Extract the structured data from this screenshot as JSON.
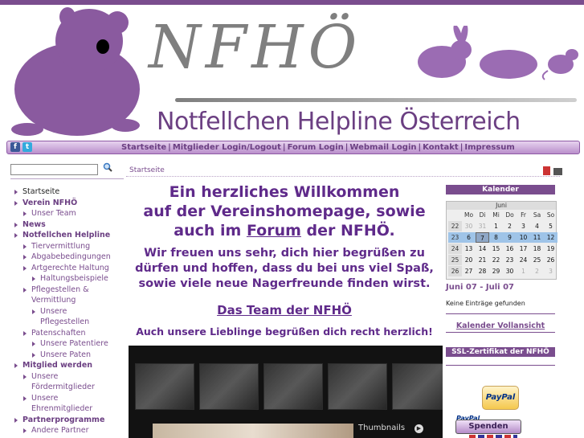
{
  "brand": {
    "logo_text": "NFHÖ",
    "slogan": "Notfellchen Helpline Österreich"
  },
  "colors": {
    "accent": "#7a4d8e",
    "heading": "#5f2a8a",
    "calendar_selected_week": "#9fc4e8"
  },
  "social": {
    "facebook_icon": "f",
    "twitter_icon": "t"
  },
  "nav": {
    "items": [
      "Startseite",
      "Mitglieder Login/Logout",
      "Forum Login",
      "Webmail Login",
      "Kontakt",
      "Impressum"
    ],
    "separator": "|"
  },
  "search": {
    "value": "",
    "button_icon": "search-icon"
  },
  "menu": [
    {
      "label": "Startseite",
      "level": 1,
      "bold": false,
      "active": true
    },
    {
      "label": "Verein NFHÖ",
      "level": 1,
      "bold": true
    },
    {
      "label": "Unser Team",
      "level": 2
    },
    {
      "label": "News",
      "level": 1,
      "bold": true
    },
    {
      "label": "Notfellchen Helpline",
      "level": 1,
      "bold": true
    },
    {
      "label": "Tiervermittlung",
      "level": 2
    },
    {
      "label": "Abgabebedingungen",
      "level": 2
    },
    {
      "label": "Artgerechte Haltung",
      "level": 2
    },
    {
      "label": "Haltungsbeispiele",
      "level": 3
    },
    {
      "label": "Pflegestellen &",
      "cont": "Vermittlung",
      "level": 2
    },
    {
      "label": "Unsere",
      "cont": "Pflegestellen",
      "level": 3
    },
    {
      "label": "Patenschaften",
      "level": 2
    },
    {
      "label": "Unsere Patentiere",
      "level": 3
    },
    {
      "label": "Unsere Paten",
      "level": 3
    },
    {
      "label": "Mitglied werden",
      "level": 1,
      "bold": true
    },
    {
      "label": "Unsere",
      "cont": "Fördermitglieder",
      "level": 2
    },
    {
      "label": "Unsere",
      "cont": "Ehrenmitglieder",
      "level": 2
    },
    {
      "label": "Partnerprogramme",
      "level": 1,
      "bold": true
    },
    {
      "label": "Andere Partner",
      "level": 2
    }
  ],
  "breadcrumb": "Startseite",
  "welcome": {
    "line1": "Ein herzliches Willkommen",
    "line2": "auf der Vereinshomepage, sowie",
    "line3_pre": "auch im ",
    "line3_link": "Forum",
    "line3_post": " der NFHÖ.",
    "para": "Wir freuen uns sehr, dich hier begrüßen zu dürfen und hoffen, dass du bei uns viel Spaß, sowie viele neue Nagerfreunde finden wirst.",
    "team": "Das Team der NFHÖ",
    "lieblinge": "Auch unsere Lieblinge begrüßen dich recht herzlich!"
  },
  "slider": {
    "thumbnails_label": "Thumbnails"
  },
  "calendar": {
    "title": "Kalender",
    "month": "Juni",
    "weekdays": [
      "Mo",
      "Di",
      "Mi",
      "Do",
      "Fr",
      "Sa",
      "So"
    ],
    "weeks": [
      {
        "num": "22",
        "days": [
          "30",
          "31",
          "1",
          "2",
          "3",
          "4",
          "5"
        ],
        "muted": [
          true,
          true,
          false,
          false,
          false,
          false,
          false
        ]
      },
      {
        "num": "23",
        "days": [
          "6",
          "7",
          "8",
          "9",
          "10",
          "11",
          "12"
        ],
        "selected": true,
        "today_index": 1
      },
      {
        "num": "24",
        "days": [
          "13",
          "14",
          "15",
          "16",
          "17",
          "18",
          "19"
        ]
      },
      {
        "num": "25",
        "days": [
          "20",
          "21",
          "22",
          "23",
          "24",
          "25",
          "26"
        ]
      },
      {
        "num": "26",
        "days": [
          "27",
          "28",
          "29",
          "30",
          "1",
          "2",
          "3"
        ],
        "muted": [
          false,
          false,
          false,
          false,
          true,
          true,
          true
        ]
      }
    ],
    "range": "Juni 07 - Juli 07",
    "no_entries": "Keine Einträge gefunden",
    "full_view": "Kalender Vollansicht"
  },
  "ssl": "SSL-Zertifikat der NFHÖ",
  "paypal": {
    "button_text": "PayPal",
    "small_logo": "PayPal",
    "donate": "Spenden"
  }
}
